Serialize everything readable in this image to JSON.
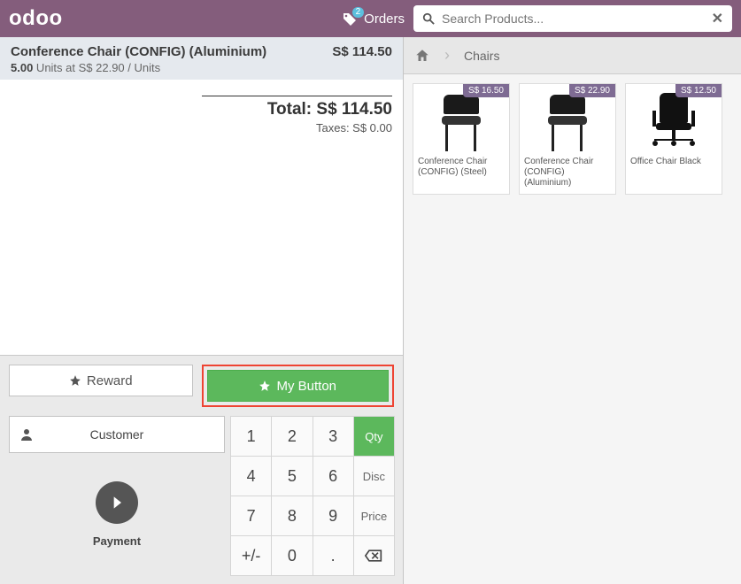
{
  "brand": "odoo",
  "topbar": {
    "orders_label": "Orders",
    "orders_count": "2",
    "search_placeholder": "Search Products..."
  },
  "order": {
    "line": {
      "name": "Conference Chair (CONFIG) (Aluminium)",
      "price": "S$ 114.50",
      "qty": "5.00",
      "units_label": " Units at S$ 22.90 / Units"
    },
    "totals": {
      "total_label": "Total: ",
      "total_value": "S$ 114.50",
      "taxes_label": "Taxes: ",
      "taxes_value": "S$ 0.00"
    }
  },
  "actions": {
    "reward": "Reward",
    "my_button": "My Button",
    "customer": "Customer",
    "payment": "Payment"
  },
  "keypad": {
    "r1": [
      "1",
      "2",
      "3"
    ],
    "r2": [
      "4",
      "5",
      "6"
    ],
    "r3": [
      "7",
      "8",
      "9"
    ],
    "r4": [
      "+/-",
      "0",
      "."
    ],
    "modes": {
      "qty": "Qty",
      "disc": "Disc",
      "price": "Price"
    },
    "backspace": "⌫"
  },
  "breadcrumb": {
    "home": "Home",
    "current": "Chairs"
  },
  "products": [
    {
      "name": "Conference Chair (CONFIG) (Steel)",
      "price": "S$ 16.50",
      "kind": "chair"
    },
    {
      "name": "Conference Chair (CONFIG) (Aluminium)",
      "price": "S$ 22.90",
      "kind": "chair"
    },
    {
      "name": "Office Chair Black",
      "price": "S$ 12.50",
      "kind": "office"
    }
  ]
}
